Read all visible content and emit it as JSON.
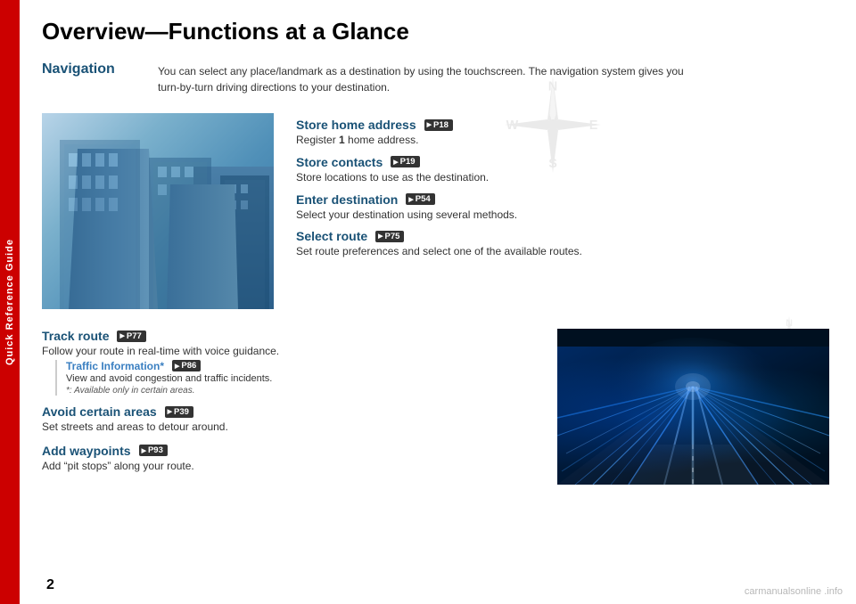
{
  "sidebar": {
    "label": "Quick Reference Guide"
  },
  "page": {
    "title": "Overview—Functions at a Glance",
    "number": "2"
  },
  "navigation": {
    "section_label": "Navigation",
    "description_line1": "You can select any place/landmark as a destination by using the touchscreen. The navigation system gives you",
    "description_line2": "turn-by-turn driving directions to your destination."
  },
  "upper_features": [
    {
      "title": "Store home address",
      "ref": "P18",
      "description": "Register 1 home address."
    },
    {
      "title": "Store contacts",
      "ref": "P19",
      "description": "Store locations to use as the destination."
    },
    {
      "title": "Enter destination",
      "ref": "P54",
      "description": "Select your destination using several methods."
    },
    {
      "title": "Select route",
      "ref": "P75",
      "description": "Set route preferences and select one of the available routes."
    }
  ],
  "lower_features": [
    {
      "title": "Track route",
      "ref": "P77",
      "description": "Follow your route in real-time with voice guidance.",
      "sub_feature": {
        "title": "Traffic Information*",
        "ref": "P86",
        "description": "View and avoid congestion and traffic incidents.",
        "note": "*: Available only in certain areas."
      }
    },
    {
      "title": "Avoid certain areas",
      "ref": "P39",
      "description": "Set streets and areas to detour around."
    },
    {
      "title": "Add waypoints",
      "ref": "P93",
      "description": "Add “pit stops” along your route."
    }
  ],
  "watermark": "carmanualsonline .info"
}
